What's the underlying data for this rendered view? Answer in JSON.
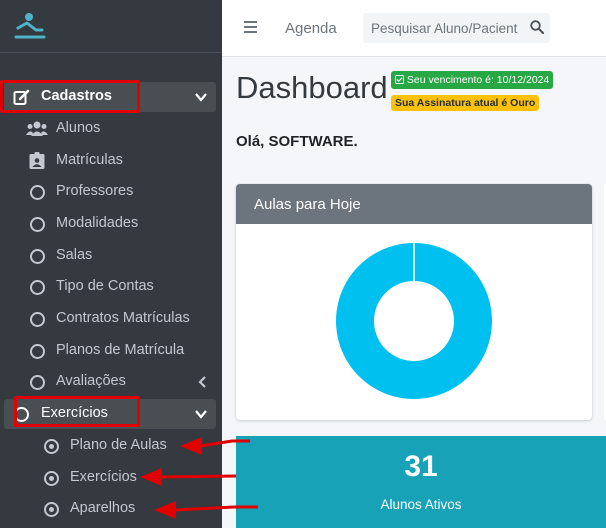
{
  "topbar": {
    "menu_icon": "hamburger-icon",
    "agenda_link": "Agenda",
    "search_placeholder": "Pesquisar Aluno/Pacient",
    "search_icon": "search-icon"
  },
  "sidebar": {
    "logo_icon": "brand-logo",
    "items": [
      {
        "label": "Cadastros",
        "icon": "edit-icon",
        "expanded": true,
        "highlighted": true
      },
      {
        "label": "Alunos",
        "icon": "users-icon"
      },
      {
        "label": "Matrículas",
        "icon": "id-card-icon"
      },
      {
        "label": "Professores",
        "icon": "circle-icon"
      },
      {
        "label": "Modalidades",
        "icon": "circle-icon"
      },
      {
        "label": "Salas",
        "icon": "circle-icon"
      },
      {
        "label": "Tipo de Contas",
        "icon": "circle-icon"
      },
      {
        "label": "Contratos Matrículas",
        "icon": "circle-icon"
      },
      {
        "label": "Planos de Matrícula",
        "icon": "circle-icon"
      },
      {
        "label": "Avaliações",
        "icon": "circle-icon",
        "chevron": "left"
      },
      {
        "label": "Exercícios",
        "icon": "circle-icon",
        "expanded": true,
        "highlighted": true
      }
    ],
    "subitems": [
      {
        "label": "Plano de Aulas",
        "icon": "dot-circle-icon"
      },
      {
        "label": "Exercícios",
        "icon": "dot-circle-icon"
      },
      {
        "label": "Aparelhos",
        "icon": "dot-circle-icon"
      }
    ]
  },
  "main": {
    "title": "Dashboard",
    "badge_due": "Seu vencimento é: 10/12/2024",
    "badge_plan": "Sua Assinatura atual é Ouro",
    "greeting": "Olá, SOFTWARE."
  },
  "card": {
    "title": "Aulas para Hoje"
  },
  "stat": {
    "value": "31",
    "label": "Alunos Ativos"
  },
  "colors": {
    "sidebar_bg": "#343a40",
    "donut": "#00c0ef",
    "stat_bg": "#17a2b8",
    "highlight": "#e00000",
    "badge_green": "#28a745",
    "badge_yellow": "#ffc107"
  },
  "chart_data": {
    "type": "pie",
    "categories": [
      ""
    ],
    "values": [
      1
    ],
    "colors": [
      "#00c0ef"
    ]
  }
}
